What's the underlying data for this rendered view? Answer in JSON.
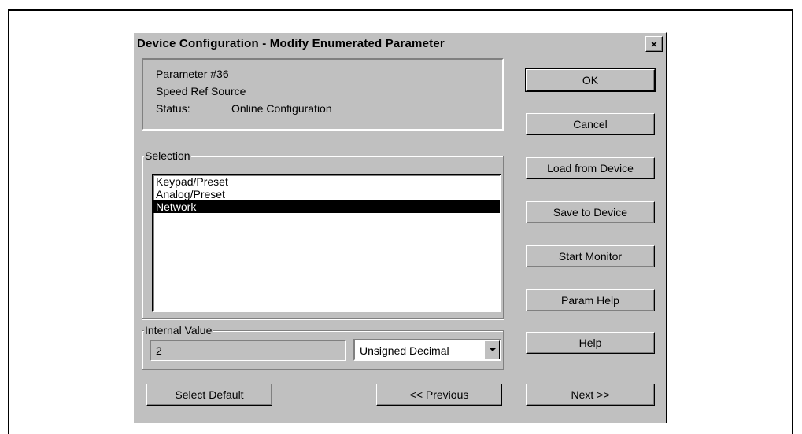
{
  "dialog": {
    "title": "Device Configuration - Modify Enumerated Parameter",
    "close_label": "×"
  },
  "info": {
    "parameter": "Parameter #36",
    "name": "Speed Ref Source",
    "status_label": "Status:",
    "status_value": "Online Configuration"
  },
  "selection": {
    "label": "Selection",
    "items": [
      "Keypad/Preset",
      "Analog/Preset",
      "Network"
    ],
    "selected_index": 2
  },
  "internal_value": {
    "label": "Internal Value",
    "value": "2",
    "format": "Unsigned Decimal"
  },
  "buttons": {
    "ok": "OK",
    "cancel": "Cancel",
    "load": "Load from Device",
    "save": "Save to Device",
    "start_monitor": "Start Monitor",
    "param_help": "Param Help",
    "help": "Help",
    "select_default": "Select Default",
    "previous": "<< Previous",
    "next": "Next >>"
  }
}
